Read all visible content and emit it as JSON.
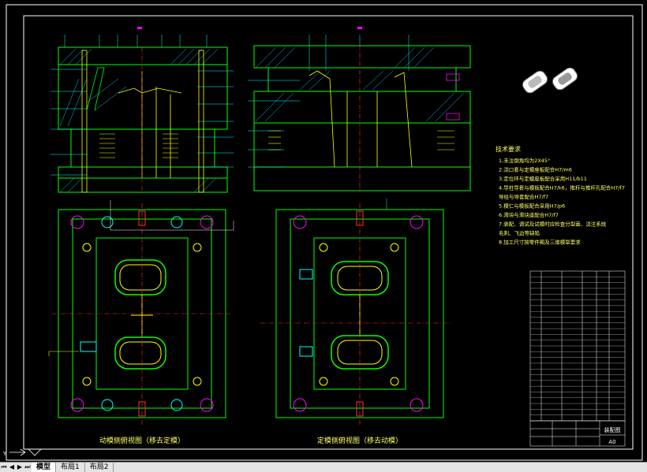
{
  "colors": {
    "background": "#000000",
    "border": "#ffffff",
    "outline": "#00ff00",
    "leader": "#00ffff",
    "hatch": "#00c8ff",
    "part": "#ffff00",
    "accent": "#ff00ff",
    "mark": "#ff3333",
    "text": "#ffff66"
  },
  "views": {
    "plan_left_caption": "动模侧俯视图（移去定模）",
    "plan_right_caption": "定模侧俯视图（移去动模）"
  },
  "notes": {
    "title": "技术要求",
    "lines": [
      "1.未注倒角均为2X45°",
      "2.浇口套与定模座板配合H7/m6",
      "3.定位环与定模座板配合采用H11/b11",
      "4.导柱导套与模板配合H7/k6，推杆与推杆孔配合H7/f7",
      "   导柱与导套配合H7/f7",
      "5.模仁与模板配合采用H7/p6",
      "6.滑块与滑块座配合H7/f7",
      "7.装配、调试及试模时应检查分型面、浇注系统",
      "   毛刺、飞边等缺陷",
      "8.加工尺寸按零件图及三维模型要求"
    ]
  },
  "title_block": {
    "name": "装配图",
    "scale": "A0"
  },
  "bom_rows": 26,
  "tabs": [
    "模型",
    "布局1",
    "布局2"
  ],
  "active_tab": "模型",
  "nav_icons": [
    "first-icon",
    "prev-icon",
    "next-icon",
    "last-icon"
  ],
  "ucs_label": "Y"
}
